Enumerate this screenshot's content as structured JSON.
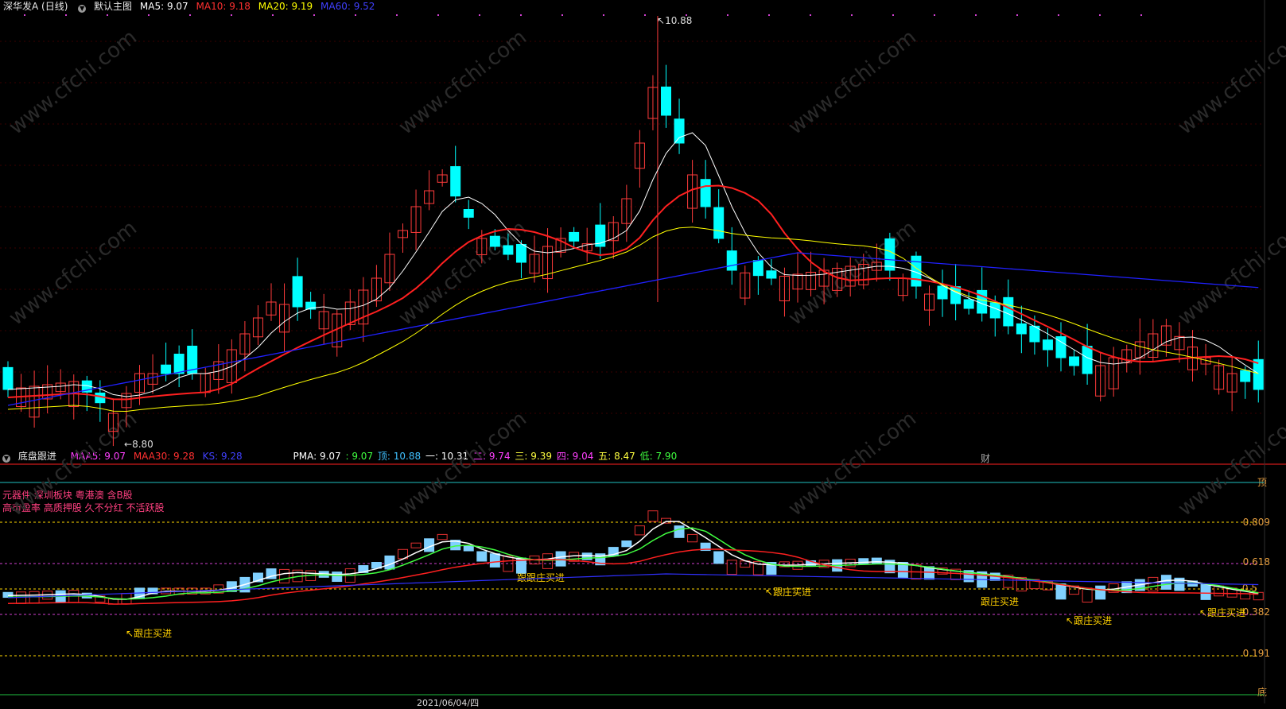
{
  "main_header": {
    "stock": "深华发A (日线)",
    "template": "默认主图",
    "ma5": "MA5: 9.07",
    "ma10": "MA10: 9.18",
    "ma20": "MA20: 9.19",
    "ma60": "MA60: 9.52"
  },
  "annotations": {
    "high": "10.88",
    "low": "8.80",
    "cai": "财"
  },
  "sub_header": {
    "name": "底盘跟进",
    "maa5": "MAA5: 9.07",
    "maa30": "MAA30: 9.28",
    "ks": "KS: 9.28",
    "pma": "PMA: 9.07",
    "v1": ": 9.07",
    "ding": "顶: 10.88",
    "yi": "一: 10.31",
    "er": "二: 9.74",
    "san": "三: 9.39",
    "si": "四: 9.04",
    "wu": "五: 8.47",
    "di": "低: 7.90"
  },
  "tags": {
    "line1": "元器件 深圳板块 粤港澳 含B股",
    "line2": "高市盈率 高质押股 久不分红 不活跃股"
  },
  "levels": [
    "0.809",
    "0.618",
    "0.5",
    "0.382",
    "0.191"
  ],
  "level_top": "顶",
  "level_bottom": "底",
  "signal_label": "跟庄买进",
  "watermark": "www.cfchi.com",
  "date_fragment": "2021/06/04/四",
  "colors": {
    "up": "#ff3b3b",
    "down": "#00ffff",
    "ma5": "#ffffff",
    "ma10": "#ff2020",
    "ma20": "#ffff00",
    "ma60": "#2020ff"
  },
  "chart_data": {
    "type": "candlestick",
    "title": "深华发A (日线)",
    "price_high": 10.88,
    "price_low": 8.8
  }
}
